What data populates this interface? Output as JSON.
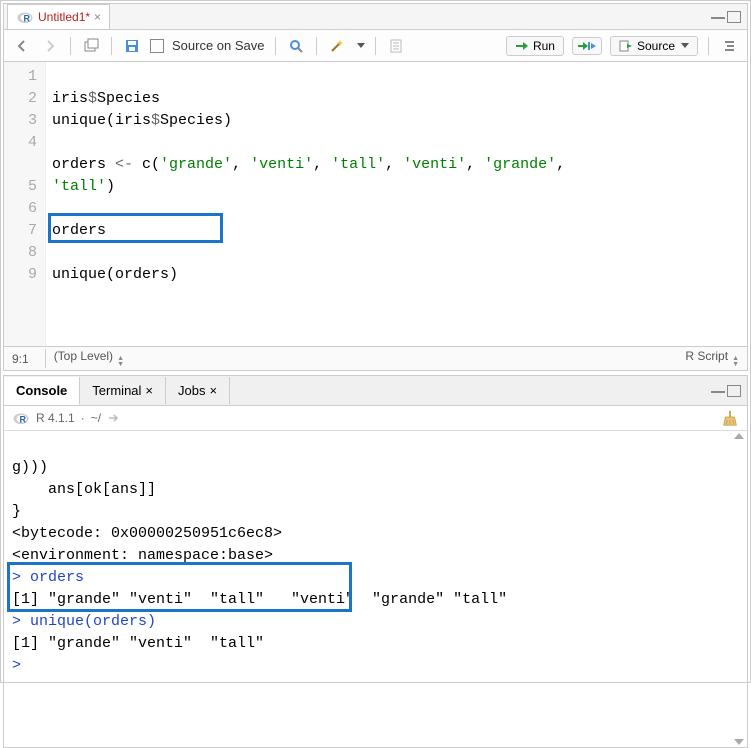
{
  "editor": {
    "tab_title": "Untitled1*",
    "source_on_save_label": "Source on Save",
    "run_label": "Run",
    "source_label": "Source",
    "cursor_pos": "9:1",
    "scope": "(Top Level)",
    "lang": "R Script",
    "lines": {
      "n1": "1",
      "n2": "2",
      "n3": "3",
      "n4": "4",
      "n5": "5",
      "n6": "6",
      "n7": "7",
      "n8": "8",
      "n9": "9"
    },
    "code": {
      "l1_a": "iris",
      "l1_b": "$",
      "l1_c": "Species",
      "l2_a": "unique",
      "l2_b": "(iris",
      "l2_c": "$",
      "l2_d": "Species)",
      "l4_a": "orders ",
      "l4_b": "<- ",
      "l4_c": "c(",
      "l4_s1": "'grande'",
      "l4_cm": ", ",
      "l4_s2": "'venti'",
      "l4_s3": "'tall'",
      "l4_s4": "'venti'",
      "l4_s5": "'grande'",
      "l4_d": ",",
      "l4w_s6": "'tall'",
      "l4w_b": ")",
      "l6": "orders",
      "l8_a": "unique",
      "l8_b": "(orders)"
    }
  },
  "tabs": {
    "console": "Console",
    "terminal": "Terminal",
    "jobs": "Jobs"
  },
  "console": {
    "r_version": "R 4.1.1",
    "path": "~/",
    "line1": "g)))",
    "line2": "    ans[ok[ans]]",
    "line3": "}",
    "line4": "<bytecode: 0x00000250951c6ec8>",
    "line5": "<environment: namespace:base>",
    "prompt": "> ",
    "cmd1": "orders",
    "out1": "[1] \"grande\" \"venti\"  \"tall\"   \"venti\"  \"grande\" \"tall\"",
    "cmd2": "unique(orders)",
    "out2": "[1] \"grande\" \"venti\"  \"tall\""
  }
}
